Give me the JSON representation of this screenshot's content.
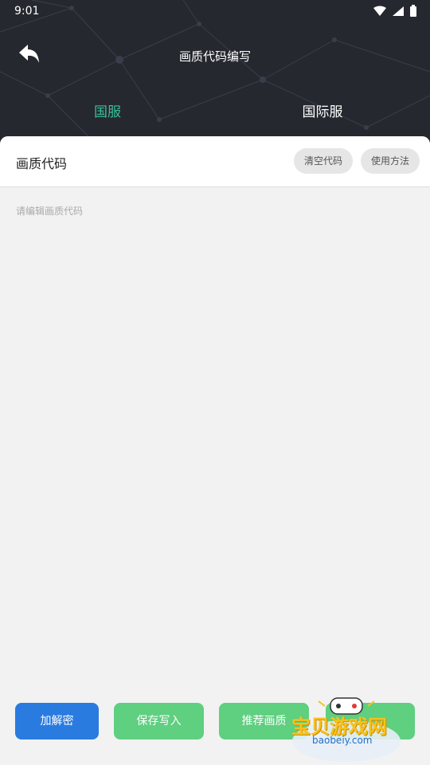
{
  "status_bar": {
    "time": "9:01"
  },
  "header": {
    "title": "画质代码编写"
  },
  "tabs": [
    {
      "label": "国服",
      "active": true
    },
    {
      "label": "国际服",
      "active": false
    }
  ],
  "card": {
    "title": "画质代码",
    "clear_label": "清空代码",
    "help_label": "使用方法",
    "editor_placeholder": "请编辑画质代码"
  },
  "actions": {
    "decrypt_label": "加解密",
    "save_label": "保存写入",
    "recommend_label": "推荐画质"
  },
  "watermark": {
    "text": "宝贝游戏网",
    "url": "baobeiy.com"
  },
  "colors": {
    "header_bg": "#262830",
    "tab_active": "#3bbf9b",
    "primary_blue": "#2a7be0",
    "primary_green": "#5fcf80"
  }
}
